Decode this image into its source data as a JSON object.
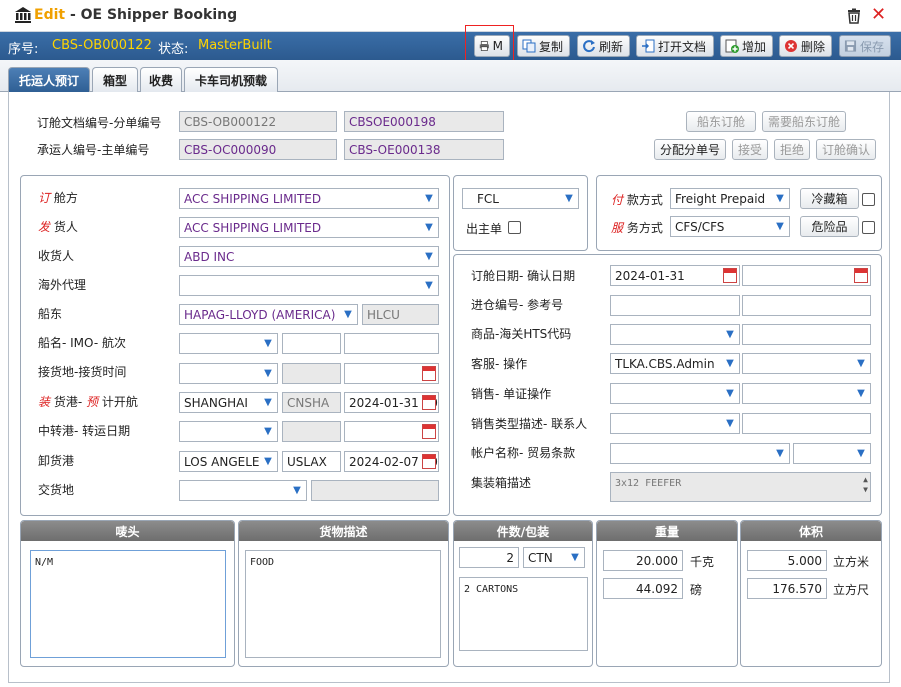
{
  "window": {
    "edit_label": "Edit",
    "title_rest": " - OE Shipper Booking"
  },
  "info": {
    "seq_label": "序号:",
    "seq_value": "CBS-OB000122",
    "status_label": "状态:",
    "status_value": "MasterBuilt"
  },
  "toolbar": {
    "print": "M",
    "copy": "复制",
    "refresh": "刷新",
    "open_doc": "打开文档",
    "add": "增加",
    "delete": "删除",
    "save": "保存"
  },
  "tabs": [
    "托运人预订",
    "箱型",
    "收费",
    "卡车司机预载"
  ],
  "top": {
    "doc_label": "订舱文档编号-分单编号",
    "doc_no": "CBS-OB000122",
    "hbl_no": "CBSOE000198",
    "carrier_label": "承运人编号-主单编号",
    "carrier_no": "CBS-OC000090",
    "mbl_no": "CBS-OE000138",
    "btn_carrier_book": "船东订舱",
    "btn_need_carrier": "需要船东订舱",
    "btn_assign": "分配分单号",
    "btn_accept": "接受",
    "btn_reject": "拒绝",
    "btn_confirm": "订舱确认"
  },
  "left": {
    "booker_prefix": "订",
    "booker_label": " 舱方",
    "booker": "ACC SHIPPING LIMITED",
    "shipper_prefix": "发",
    "shipper_label": " 货人",
    "shipper": "ACC SHIPPING LIMITED",
    "consignee_label": "收货人",
    "consignee": "ABD INC",
    "agent_label": "海外代理",
    "carrier_label": "船东",
    "carrier": "HAPAG-LLOYD (AMERICA)",
    "carrier_code": "HLCU",
    "vessel_label": "船名- IMO- 航次",
    "receipt_label": "接货地-接货时间",
    "pol_prefix1": "装",
    "pol_label1": " 货港- ",
    "pol_prefix2": "预",
    "pol_label2": " 计开航",
    "pol": "SHANGHAI",
    "pol_code": "CNSHA",
    "etd": "2024-01-31 00:0",
    "transit_label": "中转港- 转运日期",
    "pod_label": "卸货港",
    "pod": "LOS ANGELES",
    "pod_code": "USLAX",
    "eta": "2024-02-07 00:0",
    "delivery_label": "交货地"
  },
  "right": {
    "load_type": "FCL",
    "house_label": "出主单",
    "pay_prefix": "付",
    "pay_label": " 款方式",
    "pay_term": "Freight Prepaid",
    "svc_prefix": "服",
    "svc_label": " 务方式",
    "svc_term": "CFS/CFS",
    "reefer_btn": "冷藏箱",
    "dg_btn": "危险品",
    "book_date_label": "订舱日期- 确认日期",
    "book_date": "2024-01-31",
    "entry_label": "进仓编号- 参考号",
    "commodity_label": "商品-海关HTS代码",
    "cs_label": "客服- 操作",
    "cs": "TLKA.CBS.Admin",
    "sales_label": "销售- 单证操作",
    "sales_type_label": "销售类型描述- 联系人",
    "account_label": "帐户名称- 贸易条款",
    "container_label": "集装箱描述",
    "container_desc": "3x12 FEEFER"
  },
  "bottom": {
    "marks_hdr": "唛头",
    "marks": "N/M",
    "desc_hdr": "货物描述",
    "desc": "FOOD",
    "pkg_hdr": "件数/包装",
    "pkg_qty": "2",
    "pkg_unit": "CTN",
    "pkg_text": "2 CARTONS",
    "weight_hdr": "重量",
    "weight_kg": "20.000",
    "kg_unit": "千克",
    "weight_lb": "44.092",
    "lb_unit": "磅",
    "volume_hdr": "体积",
    "vol_cbm": "5.000",
    "cbm_unit": "立方米",
    "vol_cft": "176.570",
    "cft_unit": "立方尺"
  }
}
